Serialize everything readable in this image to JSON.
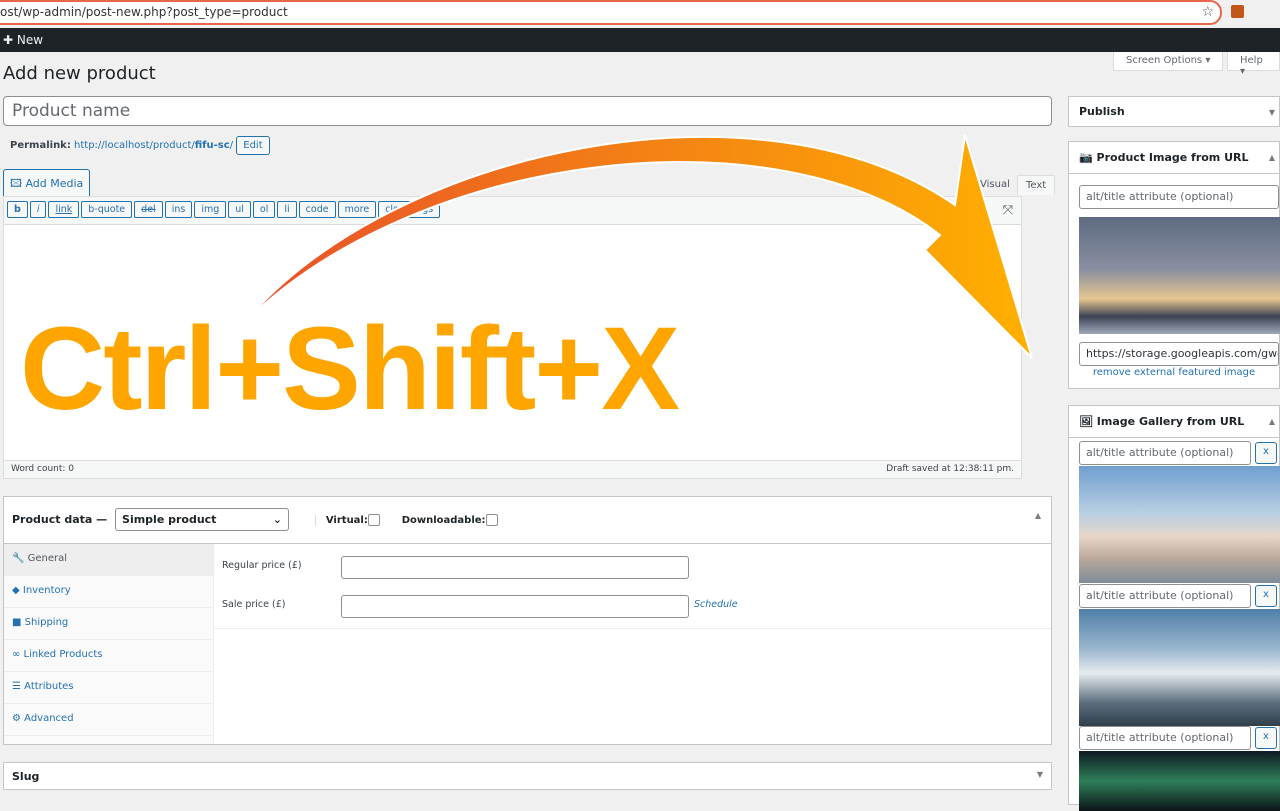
{
  "browser": {
    "url": "ost/wp-admin/post-new.php?post_type=product"
  },
  "adminbar": {
    "new_label": "New"
  },
  "header": {
    "title": "Add new product",
    "screen_options": "Screen Options ▾",
    "help": "Help ▾"
  },
  "title_field": {
    "placeholder": "Product name"
  },
  "permalink": {
    "label": "Permalink:",
    "url_prefix": "http://localhost/product/",
    "slug": "fifu-sc",
    "suffix": "/",
    "edit": "Edit"
  },
  "editor": {
    "add_media": "Add Media",
    "tabs": [
      "Visual",
      "Text"
    ],
    "quicktags": [
      "b",
      "i",
      "link",
      "b-quote",
      "del",
      "ins",
      "img",
      "ul",
      "ol",
      "li",
      "code",
      "more",
      "close tags"
    ],
    "word_count": "Word count: 0",
    "draft_saved": "Draft saved at 12:38:11 pm."
  },
  "product_data": {
    "label": "Product data —",
    "type": "Simple product",
    "virtual": "Virtual:",
    "downloadable": "Downloadable:",
    "tabs": [
      "General",
      "Inventory",
      "Shipping",
      "Linked Products",
      "Attributes",
      "Advanced"
    ],
    "regular_price": "Regular price (£)",
    "sale_price": "Sale price (£)",
    "schedule": "Schedule"
  },
  "slug": {
    "title": "Slug"
  },
  "sidebar": {
    "publish": "Publish",
    "product_image": {
      "title": "Product Image from URL",
      "alt_placeholder": "alt/title attribute (optional)",
      "url": "https://storage.googleapis.com/gwet",
      "remove": "remove external featured image"
    },
    "gallery": {
      "title": "Image Gallery from URL",
      "alt_placeholder": "alt/title attribute (optional)",
      "remove": "x"
    }
  },
  "overlay": {
    "shortcut": "Ctrl+Shift+X",
    "color": "#ffa500"
  }
}
